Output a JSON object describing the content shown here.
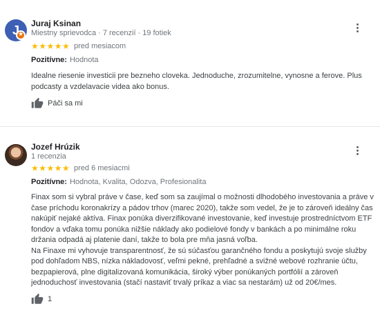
{
  "reviews": [
    {
      "avatar_letter": "J",
      "name": "Juraj Ksinan",
      "badge": "Miestny sprievodca",
      "reviews_count": "7 recenzií",
      "photos_count": "19 fotiek",
      "stars": "★★★★★",
      "rating": 5,
      "date": "pred mesiacom",
      "attr_label": "Pozitívne:",
      "attr_values": "Hodnota",
      "text": "Idealne riesenie investicii pre bezneho cloveka. Jednoduche, zrozumitelne, vynosne a ferove. Plus podcasty a vzdelavacie videa ako bonus.",
      "like_label": "Páči sa mi",
      "colors": {
        "avatar": "#3d5fb4",
        "guide_badge": "#e8710a"
      }
    },
    {
      "name": "Jozef Hrúzik",
      "reviews_count": "1 recenzia",
      "stars": "★★★★★",
      "rating": 5,
      "date": "pred 6 mesiacmi",
      "attr_label": "Pozitívne:",
      "attr_values": "Hodnota, Kvalita, Odozva, Profesionalita",
      "text_p1": "Finax som si vybral práve v čase, keď som sa zaujímal o možnosti dlhodobého investovania a práve v čase príchodu koronakrízy a pádov trhov (marec 2020), takže som vedel, že je to zároveň ideálny čas nakúpiť nejaké aktíva. Finax ponúka diverzifikované investovanie, keď investuje prostredníctvom ETF fondov a vďaka tomu ponúka nižšie náklady ako podielové fondy v bankách a po minimálne roku držania odpadá aj platenie daní, takže to bola pre mňa jasná voľba.",
      "text_p2": "Na Finaxe mi vyhovuje transparentnosť, že sú súčasťou garančného fondu a poskytujú svoje služby pod dohľadom NBS, nízka nákladovosť, veľmi pekné, prehľadné a svižné webové rozhranie účtu, bezpapierová, plne digitalizovaná komunikácia, široký výber ponúkaných portfólií a zároveň jednoduchosť investovania (stačí nastaviť trvalý príkaz a viac sa nestarám) už od 20€/mes.",
      "like_count": "1"
    }
  ],
  "colors": {
    "star": "#fbbc04",
    "muted": "#70757a",
    "text": "#3c4043"
  },
  "icons": {
    "like": "thumbs-up-icon",
    "more": "more-vert-icon",
    "guide": "local-guide-star-icon"
  }
}
